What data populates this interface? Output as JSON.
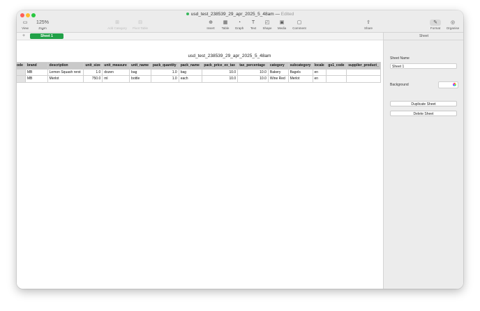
{
  "window": {
    "title": "usd_test_238539_29_apr_2025_5_48am",
    "status": "Edited"
  },
  "toolbar": {
    "view_label": "View",
    "zoom_value": "125%",
    "zoom_label": "Zoom",
    "add_category_label": "Add Category",
    "pivot_table_label": "Pivot Table",
    "insert_label": "Insert",
    "table_label": "Table",
    "graph_label": "Graph",
    "text_label": "Text",
    "shape_label": "Shape",
    "media_label": "Media",
    "comment_label": "Comment",
    "share_label": "Share",
    "format_label": "Format",
    "organise_label": "Organise"
  },
  "icons": {
    "view": "sidebar-icon",
    "zoom": "chevron-down-icon",
    "add_category": "add-category-icon",
    "pivot_table": "pivot-table-icon",
    "insert": "insert-icon",
    "table": "table-icon",
    "graph": "graph-icon",
    "text": "text-icon",
    "shape": "shape-icon",
    "media": "media-icon",
    "comment": "comment-icon",
    "share": "share-icon",
    "format": "paintbrush-icon",
    "organise": "organise-icon"
  },
  "sheets": {
    "add_label": "+",
    "tabs": [
      {
        "label": "Sheet 1",
        "active": true
      }
    ]
  },
  "table": {
    "title": "usd_test_238539_29_apr_2025_5_48am",
    "columns": [
      "ode",
      "brand",
      "description",
      "unit_size",
      "unit_measure",
      "unit_name",
      "pack_quantity",
      "pack_name",
      "pack_price_ex_tax",
      "tax_percentage",
      "category",
      "subcategory",
      "locale",
      "gs1_code",
      "supplier_product_"
    ],
    "rows": [
      [
        "",
        "MB",
        "Lemon Squash rerst",
        "1.0",
        "dozen",
        "bag",
        "1.0",
        "bag",
        "10.0",
        "10.0",
        "Bakery",
        "Bagels",
        "en",
        "",
        ""
      ],
      [
        "",
        "MB",
        "Merlot",
        "750.0",
        "ml",
        "bottle",
        "1.0",
        "each",
        "10.0",
        "10.0",
        "Wine Red",
        "Merlot",
        "en",
        "",
        ""
      ]
    ]
  },
  "inspector": {
    "heading": "Sheet",
    "sheet_name_label": "Sheet Name",
    "sheet_name_value": "Sheet 1",
    "background_label": "Background",
    "duplicate_label": "Duplicate Sheet",
    "delete_label": "Delete Sheet"
  },
  "colors": {
    "accent_green": "#21a148",
    "close": "#fe5f57",
    "minimize": "#febc2e",
    "maximize": "#28c840"
  }
}
